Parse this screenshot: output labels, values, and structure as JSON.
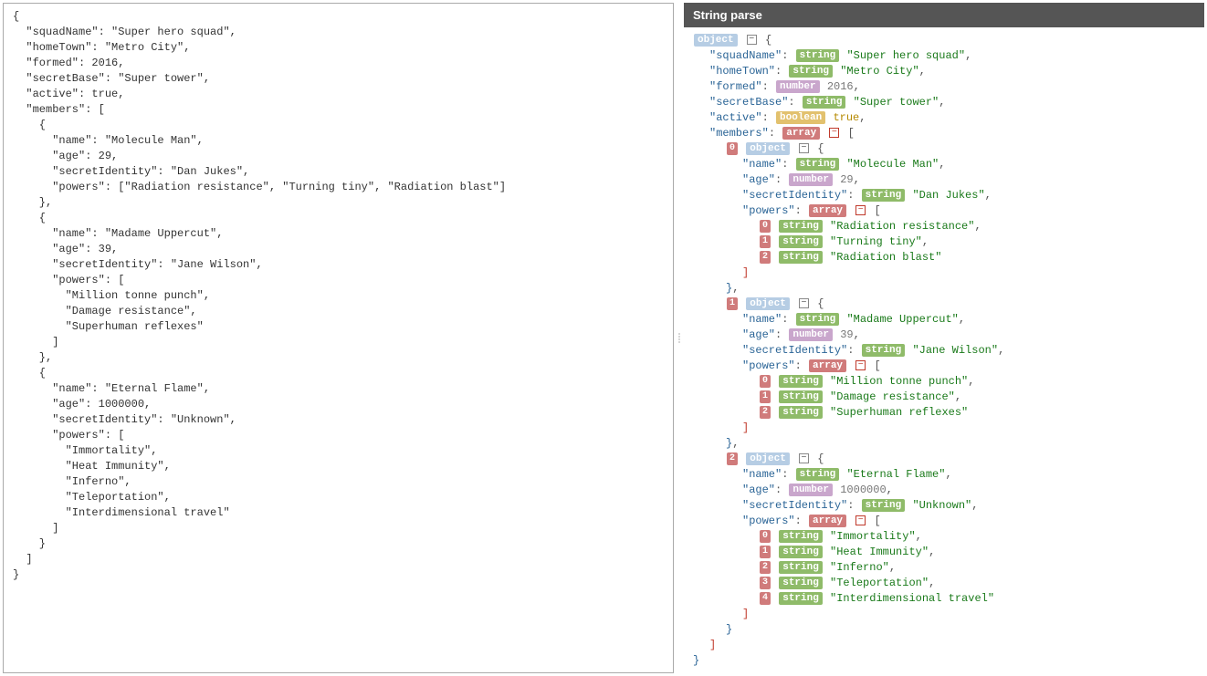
{
  "header": {
    "title": "String parse"
  },
  "raw_json_text": "{\n  \"squadName\": \"Super hero squad\",\n  \"homeTown\": \"Metro City\",\n  \"formed\": 2016,\n  \"secretBase\": \"Super tower\",\n  \"active\": true,\n  \"members\": [\n    {\n      \"name\": \"Molecule Man\",\n      \"age\": 29,\n      \"secretIdentity\": \"Dan Jukes\",\n      \"powers\": [\"Radiation resistance\", \"Turning tiny\", \"Radiation blast\"]\n    },\n    {\n      \"name\": \"Madame Uppercut\",\n      \"age\": 39,\n      \"secretIdentity\": \"Jane Wilson\",\n      \"powers\": [\n        \"Million tonne punch\",\n        \"Damage resistance\",\n        \"Superhuman reflexes\"\n      ]\n    },\n    {\n      \"name\": \"Eternal Flame\",\n      \"age\": 1000000,\n      \"secretIdentity\": \"Unknown\",\n      \"powers\": [\n        \"Immortality\",\n        \"Heat Immunity\",\n        \"Inferno\",\n        \"Teleportation\",\n        \"Interdimensional travel\"\n      ]\n    }\n  ]\n}",
  "types": {
    "object": "object",
    "string": "string",
    "number": "number",
    "boolean": "boolean",
    "array": "array"
  },
  "parsed": {
    "squadName": "Super hero squad",
    "homeTown": "Metro City",
    "formed": 2016,
    "secretBase": "Super tower",
    "active": true,
    "members": [
      {
        "name": "Molecule Man",
        "age": 29,
        "secretIdentity": "Dan Jukes",
        "powers": [
          "Radiation resistance",
          "Turning tiny",
          "Radiation blast"
        ]
      },
      {
        "name": "Madame Uppercut",
        "age": 39,
        "secretIdentity": "Jane Wilson",
        "powers": [
          "Million tonne punch",
          "Damage resistance",
          "Superhuman reflexes"
        ]
      },
      {
        "name": "Eternal Flame",
        "age": 1000000,
        "secretIdentity": "Unknown",
        "powers": [
          "Immortality",
          "Heat Immunity",
          "Inferno",
          "Teleportation",
          "Interdimensional travel"
        ]
      }
    ]
  }
}
